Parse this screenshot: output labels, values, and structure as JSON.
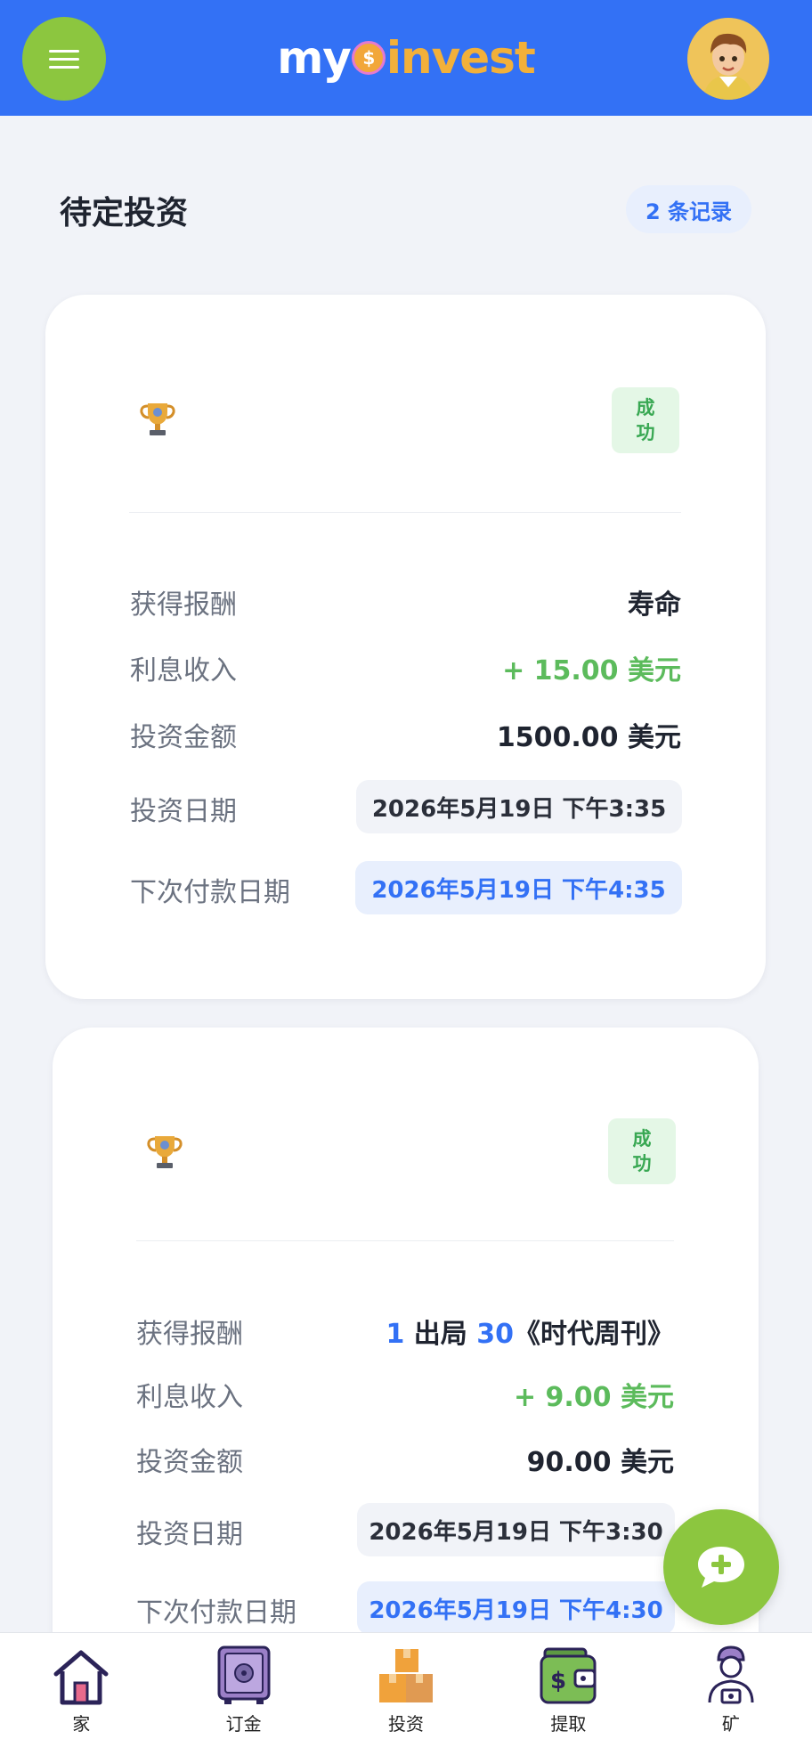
{
  "header": {
    "logo_part1": "my",
    "logo_coin": "$",
    "logo_part2": "invest",
    "menu_icon": "hamburger-icon",
    "avatar": "user-avatar"
  },
  "section": {
    "title": "待定投资",
    "record_count": "2 条记录"
  },
  "investments": [
    {
      "icon": "trophy-icon",
      "status": "成功",
      "reward_label": "获得报酬",
      "reward_value": "寿命",
      "interest_label": "利息收入",
      "interest_value": "+ 15.00 美元",
      "amount_label": "投资金额",
      "amount_value": "1500.00 美元",
      "date_label": "投资日期",
      "date_value": "2026年5月19日 下午3:35",
      "next_label": "下次付款日期",
      "next_value": "2026年5月19日 下午4:35"
    },
    {
      "icon": "trophy-icon",
      "status": "成功",
      "reward_label": "获得报酬",
      "reward_num1": "1",
      "reward_mid": " 出局 ",
      "reward_num2": "30",
      "reward_tail": "《时代周刊》",
      "interest_label": "利息收入",
      "interest_value": "+ 9.00 美元",
      "amount_label": "投资金额",
      "amount_value": "90.00 美元",
      "date_label": "投资日期",
      "date_value": "2026年5月19日 下午3:30",
      "next_label": "下次付款日期",
      "next_value": "2026年5月19日 下午4:30"
    }
  ],
  "chat": {
    "icon": "chat-plus-icon"
  },
  "nav": [
    {
      "label": "家",
      "icon": "home-icon"
    },
    {
      "label": "订金",
      "icon": "safe-icon"
    },
    {
      "label": "投资",
      "icon": "boxes-icon"
    },
    {
      "label": "提取",
      "icon": "wallet-icon"
    },
    {
      "label": "矿",
      "icon": "miner-icon"
    }
  ],
  "colors": {
    "header_bg": "#3371f5",
    "accent_green": "#8cc63f",
    "income_green": "#5cbb5c",
    "link_blue": "#3371f5"
  }
}
